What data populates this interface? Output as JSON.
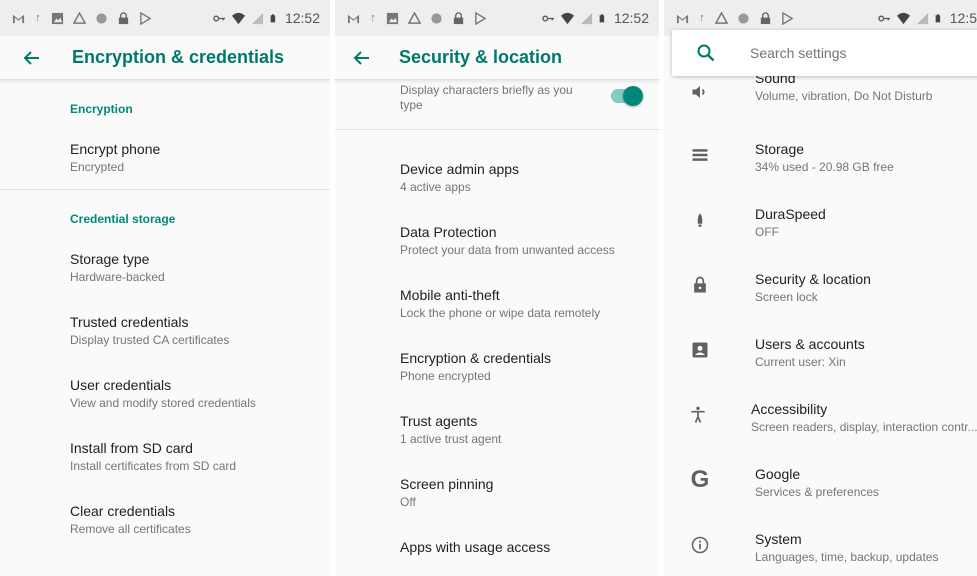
{
  "status": {
    "time": "12:52",
    "time_truncated": "12:5"
  },
  "panel1": {
    "title": "Encryption & credentials",
    "sections": [
      {
        "header": "Encryption",
        "items": [
          {
            "title": "Encrypt phone",
            "summary": "Encrypted"
          }
        ]
      },
      {
        "header": "Credential storage",
        "items": [
          {
            "title": "Storage type",
            "summary": "Hardware-backed"
          },
          {
            "title": "Trusted credentials",
            "summary": "Display trusted CA certificates"
          },
          {
            "title": "User credentials",
            "summary": "View and modify stored credentials"
          },
          {
            "title": "Install from SD card",
            "summary": "Install certificates from SD card"
          },
          {
            "title": "Clear credentials",
            "summary": "Remove all certificates"
          }
        ]
      }
    ]
  },
  "panel2": {
    "title": "Security & location",
    "partial_item": {
      "summary": "Display characters briefly as you type",
      "toggle_on": true
    },
    "items": [
      {
        "title": "Device admin apps",
        "summary": "4 active apps"
      },
      {
        "title": "Data Protection",
        "summary": "Protect your data from unwanted access"
      },
      {
        "title": "Mobile anti-theft",
        "summary": "Lock the phone or wipe data remotely"
      },
      {
        "title": "Encryption & credentials",
        "summary": "Phone encrypted"
      },
      {
        "title": "Trust agents",
        "summary": "1 active trust agent"
      },
      {
        "title": "Screen pinning",
        "summary": "Off"
      },
      {
        "title": "Apps with usage access",
        "summary": ""
      }
    ]
  },
  "panel3": {
    "search_placeholder": "Search settings",
    "items": [
      {
        "title": "Sound",
        "summary": "Volume, vibration, Do Not Disturb",
        "icon": "volume-icon"
      },
      {
        "title": "Storage",
        "summary": "34% used - 20.98 GB free",
        "icon": "storage-icon"
      },
      {
        "title": "DuraSpeed",
        "summary": "OFF",
        "icon": "rocket-icon"
      },
      {
        "title": "Security & location",
        "summary": "Screen lock",
        "icon": "lock-icon"
      },
      {
        "title": "Users & accounts",
        "summary": "Current user: Xin",
        "icon": "account-icon"
      },
      {
        "title": "Accessibility",
        "summary": "Screen readers, display, interaction contr...",
        "icon": "accessibility-icon"
      },
      {
        "title": "Google",
        "summary": "Services & preferences",
        "icon": "google-icon"
      },
      {
        "title": "System",
        "summary": "Languages, time, backup, updates",
        "icon": "info-icon"
      }
    ]
  },
  "colors": {
    "accent": "#00796b",
    "accent_light": "#00897b",
    "toggle_track": "#80cbc4"
  }
}
